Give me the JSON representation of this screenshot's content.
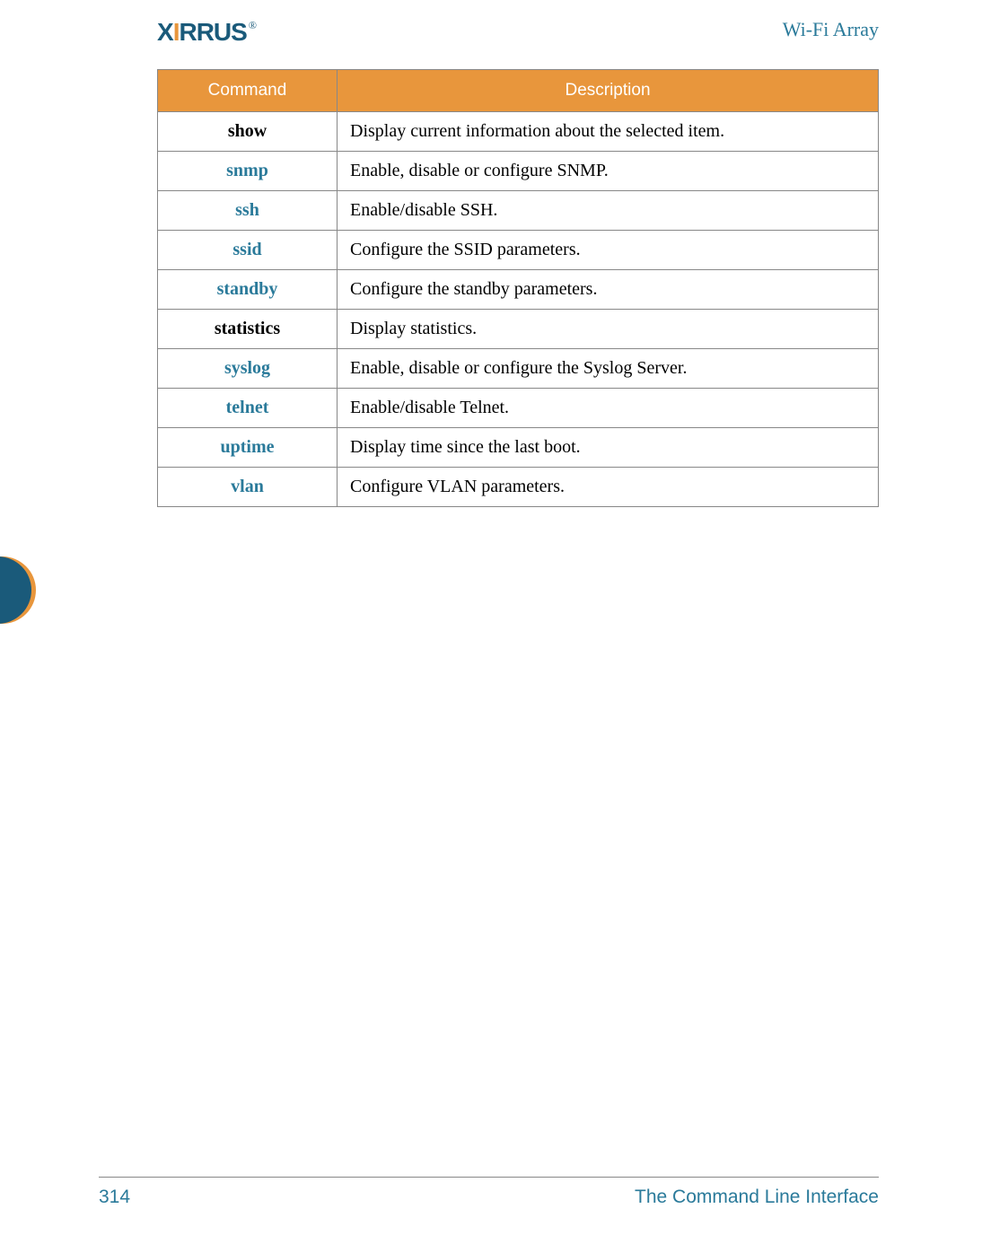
{
  "header": {
    "logo_text": "XIRRUS",
    "title": "Wi-Fi Array"
  },
  "table": {
    "headers": {
      "command": "Command",
      "description": "Description"
    },
    "rows": [
      {
        "command": "show",
        "link": false,
        "description": "Display current information about the selected item."
      },
      {
        "command": "snmp",
        "link": true,
        "description": "Enable, disable or configure SNMP."
      },
      {
        "command": "ssh",
        "link": true,
        "description": "Enable/disable SSH."
      },
      {
        "command": "ssid",
        "link": true,
        "description": "Configure the SSID parameters."
      },
      {
        "command": "standby",
        "link": true,
        "description": "Configure the standby parameters."
      },
      {
        "command": "statistics",
        "link": false,
        "description": "Display statistics."
      },
      {
        "command": "syslog",
        "link": true,
        "description": "Enable, disable or configure the Syslog Server."
      },
      {
        "command": "telnet",
        "link": true,
        "description": "Enable/disable Telnet."
      },
      {
        "command": "uptime",
        "link": true,
        "description": "Display time since the last boot."
      },
      {
        "command": "vlan",
        "link": true,
        "description": "Configure VLAN parameters."
      }
    ]
  },
  "footer": {
    "page_number": "314",
    "section_title": "The Command Line Interface"
  }
}
